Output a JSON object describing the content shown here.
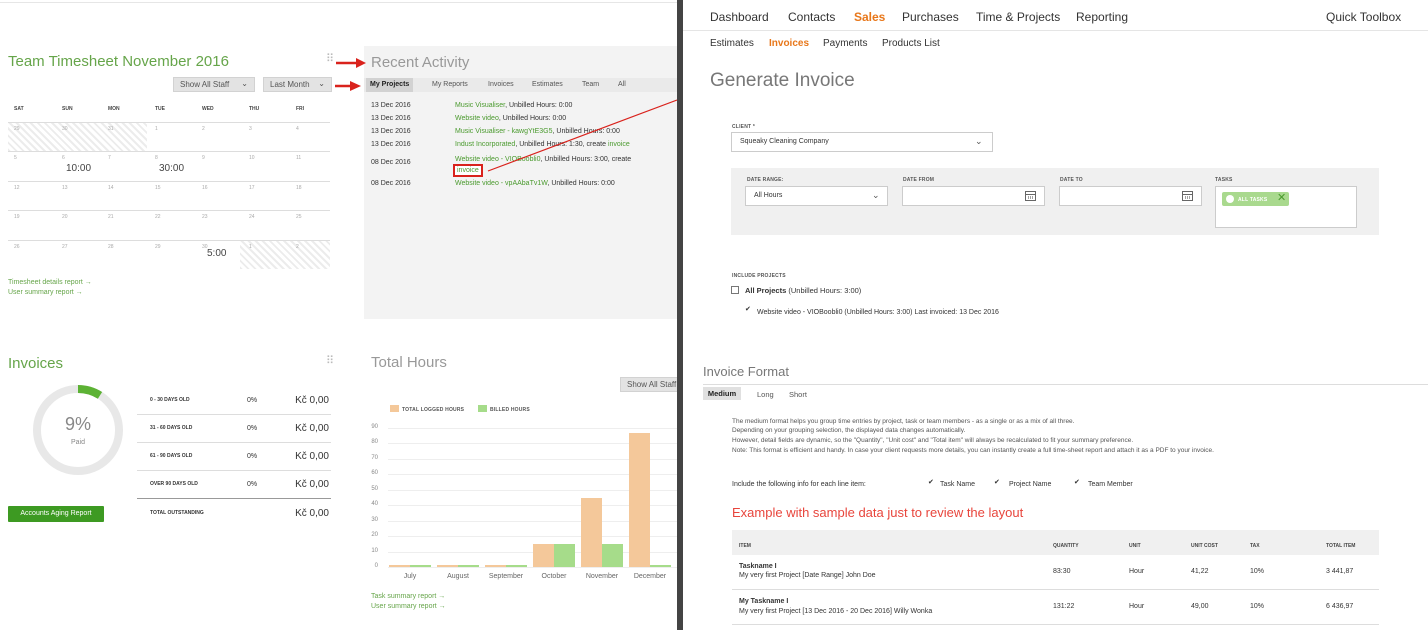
{
  "timesheet": {
    "title": "Team Timesheet November 2016",
    "show_all_staff": "Show All Staff",
    "last_month": "Last Month",
    "days": [
      "SAT",
      "SUN",
      "MON",
      "TUE",
      "WED",
      "THU",
      "FRI"
    ],
    "weeks": [
      [
        "29",
        "30",
        "31",
        "1",
        "2",
        "3",
        "4"
      ],
      [
        "5",
        "6",
        "7",
        "8",
        "9",
        "10",
        "11"
      ],
      [
        "12",
        "13",
        "14",
        "15",
        "16",
        "17",
        "18"
      ],
      [
        "19",
        "20",
        "21",
        "22",
        "23",
        "24",
        "25"
      ],
      [
        "26",
        "27",
        "28",
        "29",
        "30",
        "1",
        "2"
      ]
    ],
    "hours": {
      "h1": "10:00",
      "h2": "30:00",
      "h3": "5:00"
    },
    "links": [
      "Timesheet details report →",
      "User summary report →"
    ]
  },
  "recent": {
    "title": "Recent Activity",
    "tabs": [
      "My Projects",
      "My Reports",
      "Invoices",
      "Estimates",
      "Team",
      "All"
    ],
    "rows": [
      {
        "date": "13 Dec 2016",
        "link": "Music Visualiser",
        "text": ", Unbilled Hours: 0:00"
      },
      {
        "date": "13 Dec 2016",
        "link": "Website video",
        "text": ", Unbilled Hours: 0:00"
      },
      {
        "date": "13 Dec 2016",
        "link": "Music Visualiser - kawgYtE3G5",
        "text": ", Unbilled Hours: 0:00"
      },
      {
        "date": "13 Dec 2016",
        "link": "Indust Incorporated",
        "text": ", Unbilled Hours: 1:30, create",
        "link2": "invoice"
      },
      {
        "date": "08 Dec 2016",
        "link": "Website video - VIOBoobli0",
        "text": ", Unbilled Hours: 3:00, create",
        "link2": "invoice"
      },
      {
        "date": "08 Dec 2016",
        "link": "Website video - vpAAbaTv1W",
        "text": ", Unbilled Hours: 0:00"
      }
    ]
  },
  "invoices": {
    "title": "Invoices",
    "percent": "9%",
    "paid": "Paid",
    "paid_fraction": 0.09,
    "button": "Accounts Aging Report",
    "rows": [
      {
        "label": "0 - 30 DAYS OLD",
        "pct": "0%",
        "amt": "Kč 0,00"
      },
      {
        "label": "31 - 60 DAYS OLD",
        "pct": "0%",
        "amt": "Kč 0,00"
      },
      {
        "label": "61 - 90 DAYS OLD",
        "pct": "0%",
        "amt": "Kč 0,00"
      },
      {
        "label": "OVER 90 DAYS OLD",
        "pct": "0%",
        "amt": "Kč 0,00"
      },
      {
        "label": "TOTAL OUTSTANDING",
        "pct": "",
        "amt": "Kč 0,00"
      }
    ]
  },
  "total_hours": {
    "title": "Total Hours",
    "show_all_staff": "Show All Staff",
    "links": [
      "Task summary report →",
      "User summary report →"
    ]
  },
  "chart_data": {
    "type": "bar",
    "categories": [
      "July",
      "August",
      "September",
      "October",
      "November",
      "December"
    ],
    "series": [
      {
        "name": "TOTAL LOGGED HOURS",
        "color": "#f4c89a",
        "values": [
          1,
          1,
          1,
          15,
          45,
          87
        ]
      },
      {
        "name": "BILLED HOURS",
        "color": "#a6dc8a",
        "values": [
          1,
          1,
          1,
          15,
          15,
          1
        ]
      }
    ],
    "ylim": [
      0,
      90
    ],
    "yticks": [
      0,
      10,
      20,
      30,
      40,
      50,
      60,
      70,
      80,
      90
    ],
    "legend": "top-left",
    "grid": true
  },
  "right": {
    "nav": [
      "Dashboard",
      "Contacts",
      "Sales",
      "Purchases",
      "Time & Projects",
      "Reporting"
    ],
    "quick_toolbox": "Quick Toolbox",
    "subnav": [
      "Estimates",
      "Invoices",
      "Payments",
      "Products List"
    ],
    "page_title": "Generate Invoice",
    "client_label": "CLIENT *",
    "client_value": "Squeaky Cleaning Company",
    "date_range_label": "DATE RANGE:",
    "date_range_value": "All Hours",
    "date_from_label": "DATE FROM",
    "date_to_label": "DATE TO",
    "tasks_label": "TASKS",
    "all_tasks_chip": "ALL TASKS",
    "include_projects_label": "INCLUDE PROJECTS",
    "all_projects": "All Projects",
    "all_projects_hours": "(Unbilled Hours: 3:00)",
    "project_item": "Website video - VIOBoobli0 (Unbilled Hours: 3:00) Last invoiced: 13 Dec 2016",
    "format_title": "Invoice Format",
    "format_tabs": [
      "Medium",
      "Long",
      "Short"
    ],
    "format_desc": [
      "The medium format helps you group time entries by project, task or team members - as a single or as a mix of all three.",
      "Depending on your grouping selection, the displayed data changes automatically.",
      "However, detail fields are dynamic, so the \"Quantity\", \"Unit cost\" and \"Total item\" will always be recalculated to fit your summary preference.",
      "Note: This format is efficient and handy. In case your client requests more details, you can instantly create a full time-sheet report and attach it as a PDF to your invoice."
    ],
    "include_info": "Include the following info for each line item:",
    "opt_task": "Task Name",
    "opt_project": "Project Name",
    "opt_member": "Team Member",
    "example_title": "Example with sample data just to review the layout",
    "table_headers": [
      "ITEM",
      "QUANTITY",
      "UNIT",
      "UNIT COST",
      "TAX",
      "TOTAL ITEM"
    ],
    "table_rows": [
      {
        "name": "Taskname I",
        "desc": "My very first Project [Date Range] John Doe",
        "qty": "83:30",
        "unit": "Hour",
        "cost": "41,22",
        "tax": "10%",
        "total": "3 441,87"
      },
      {
        "name": "My Taskname I",
        "desc": "My very first Project [13 Dec 2016 - 20 Dec 2016] Willy Wonka",
        "qty": "131:22",
        "unit": "Hour",
        "cost": "49,00",
        "tax": "10%",
        "total": "6 436,97"
      }
    ]
  }
}
